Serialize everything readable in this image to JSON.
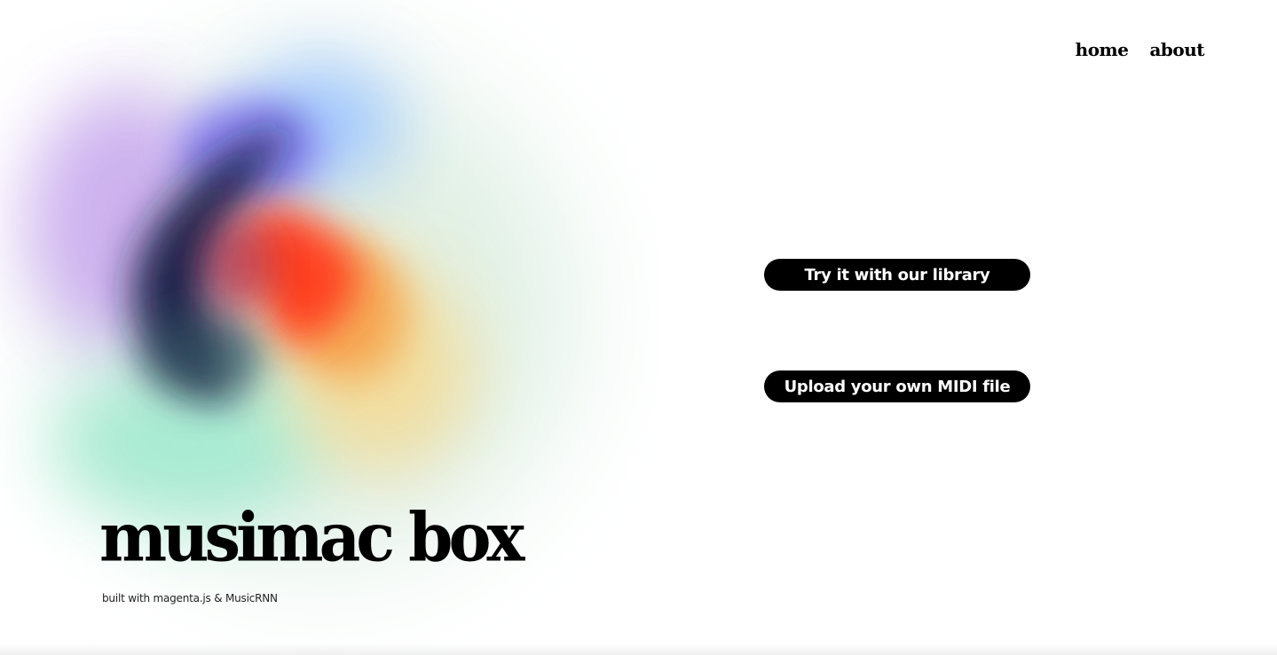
{
  "nav": {
    "home_label": "home",
    "about_label": "about"
  },
  "actions": {
    "library_label": "Try it with our library",
    "upload_label": "Upload your own MIDI file"
  },
  "brand": {
    "title": "musimac box",
    "subtitle": "built with magenta.js & MusicRNN"
  },
  "colors": {
    "button_bg": "#000000",
    "button_text": "#ffffff",
    "page_bg": "#ffffff",
    "orb_palette": [
      "#1a1f4a",
      "#ff3b1f",
      "#9cc4ff",
      "#8a7cf0",
      "#a8ecd4",
      "#f5d98a",
      "#d6b6ef"
    ]
  }
}
